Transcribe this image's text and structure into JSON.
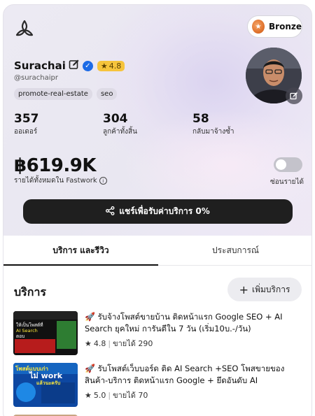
{
  "header": {
    "tier_label": "Bronze"
  },
  "profile": {
    "name": "Surachai",
    "rating": "4.8",
    "username": "@surachaipr",
    "tags": [
      "promote-real-estate",
      "seo"
    ]
  },
  "stats": [
    {
      "value": "357",
      "label": "ออเดอร์"
    },
    {
      "value": "304",
      "label": "ลูกค้าทั้งสิ้น"
    },
    {
      "value": "58",
      "label": "กลับมาจ้างซ้ำ"
    }
  ],
  "revenue": {
    "amount": "฿619.9K",
    "label": "รายได้ทั้งหมดใน Fastwork",
    "toggle_label": "ซ่อนรายได้"
  },
  "share_button": "แชร์เพื่อรับค่าบริการ 0%",
  "tabs": [
    "บริการ และรีวิว",
    "ประสบการณ์"
  ],
  "services_section": {
    "title": "บริการ",
    "add_button": "เพิ่มบริการ"
  },
  "services": [
    {
      "title": "รับจ้างโพสต์ขายบ้าน ติดหน้าแรก Google SEO + AI Search ยุคใหม่ การันตีใน 7 วัน (เริ่ม10บ.-/วัน)",
      "rating": "4.8",
      "sold": "ขายได้ 290",
      "thumb_text": [
        "ให้เป็นโพสต์ที่",
        "AI Search",
        "ตอบ"
      ]
    },
    {
      "title": "รับโพสต์เว็บบอร์ด ติด AI Search +SEO โพสขายของ สินค้า-บริการ ติดหน้าแรก Google + ยึดอันดับ AI",
      "rating": "5.0",
      "sold": "ขายได้ 70",
      "thumb_text": [
        "โพสต์แบบเก่า",
        "ไม่ work",
        "แล้วนะครับ"
      ]
    }
  ],
  "colors": {
    "accent_dark": "#1f1f1f",
    "rating_badge": "#f6c43c",
    "verified": "#1d6be6",
    "tier": "#e0732d"
  }
}
